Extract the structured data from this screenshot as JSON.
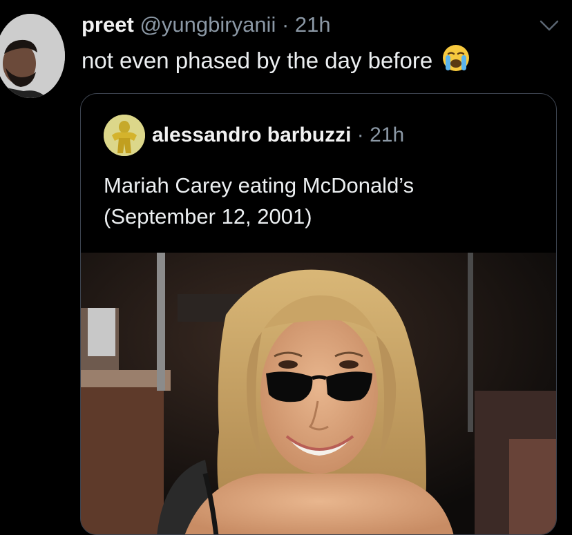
{
  "tweet": {
    "author_name": "preet",
    "author_handle": "@yungbiryanii",
    "separator": "·",
    "time": "21h",
    "text": "not even phased by the day before",
    "emoji_icon": "loudly-crying-face-icon"
  },
  "quoted_tweet": {
    "author_name": "alessandro barbuzzi",
    "separator": "·",
    "time": "21h",
    "text_line_1": "Mariah Carey eating McDonald’s",
    "text_line_2": "(September 12, 2001)",
    "media": "photo"
  },
  "colors": {
    "background": "#000000",
    "text": "#e7e9ea",
    "secondary_text": "#8b98a5",
    "quote_border": "#3d4450"
  }
}
